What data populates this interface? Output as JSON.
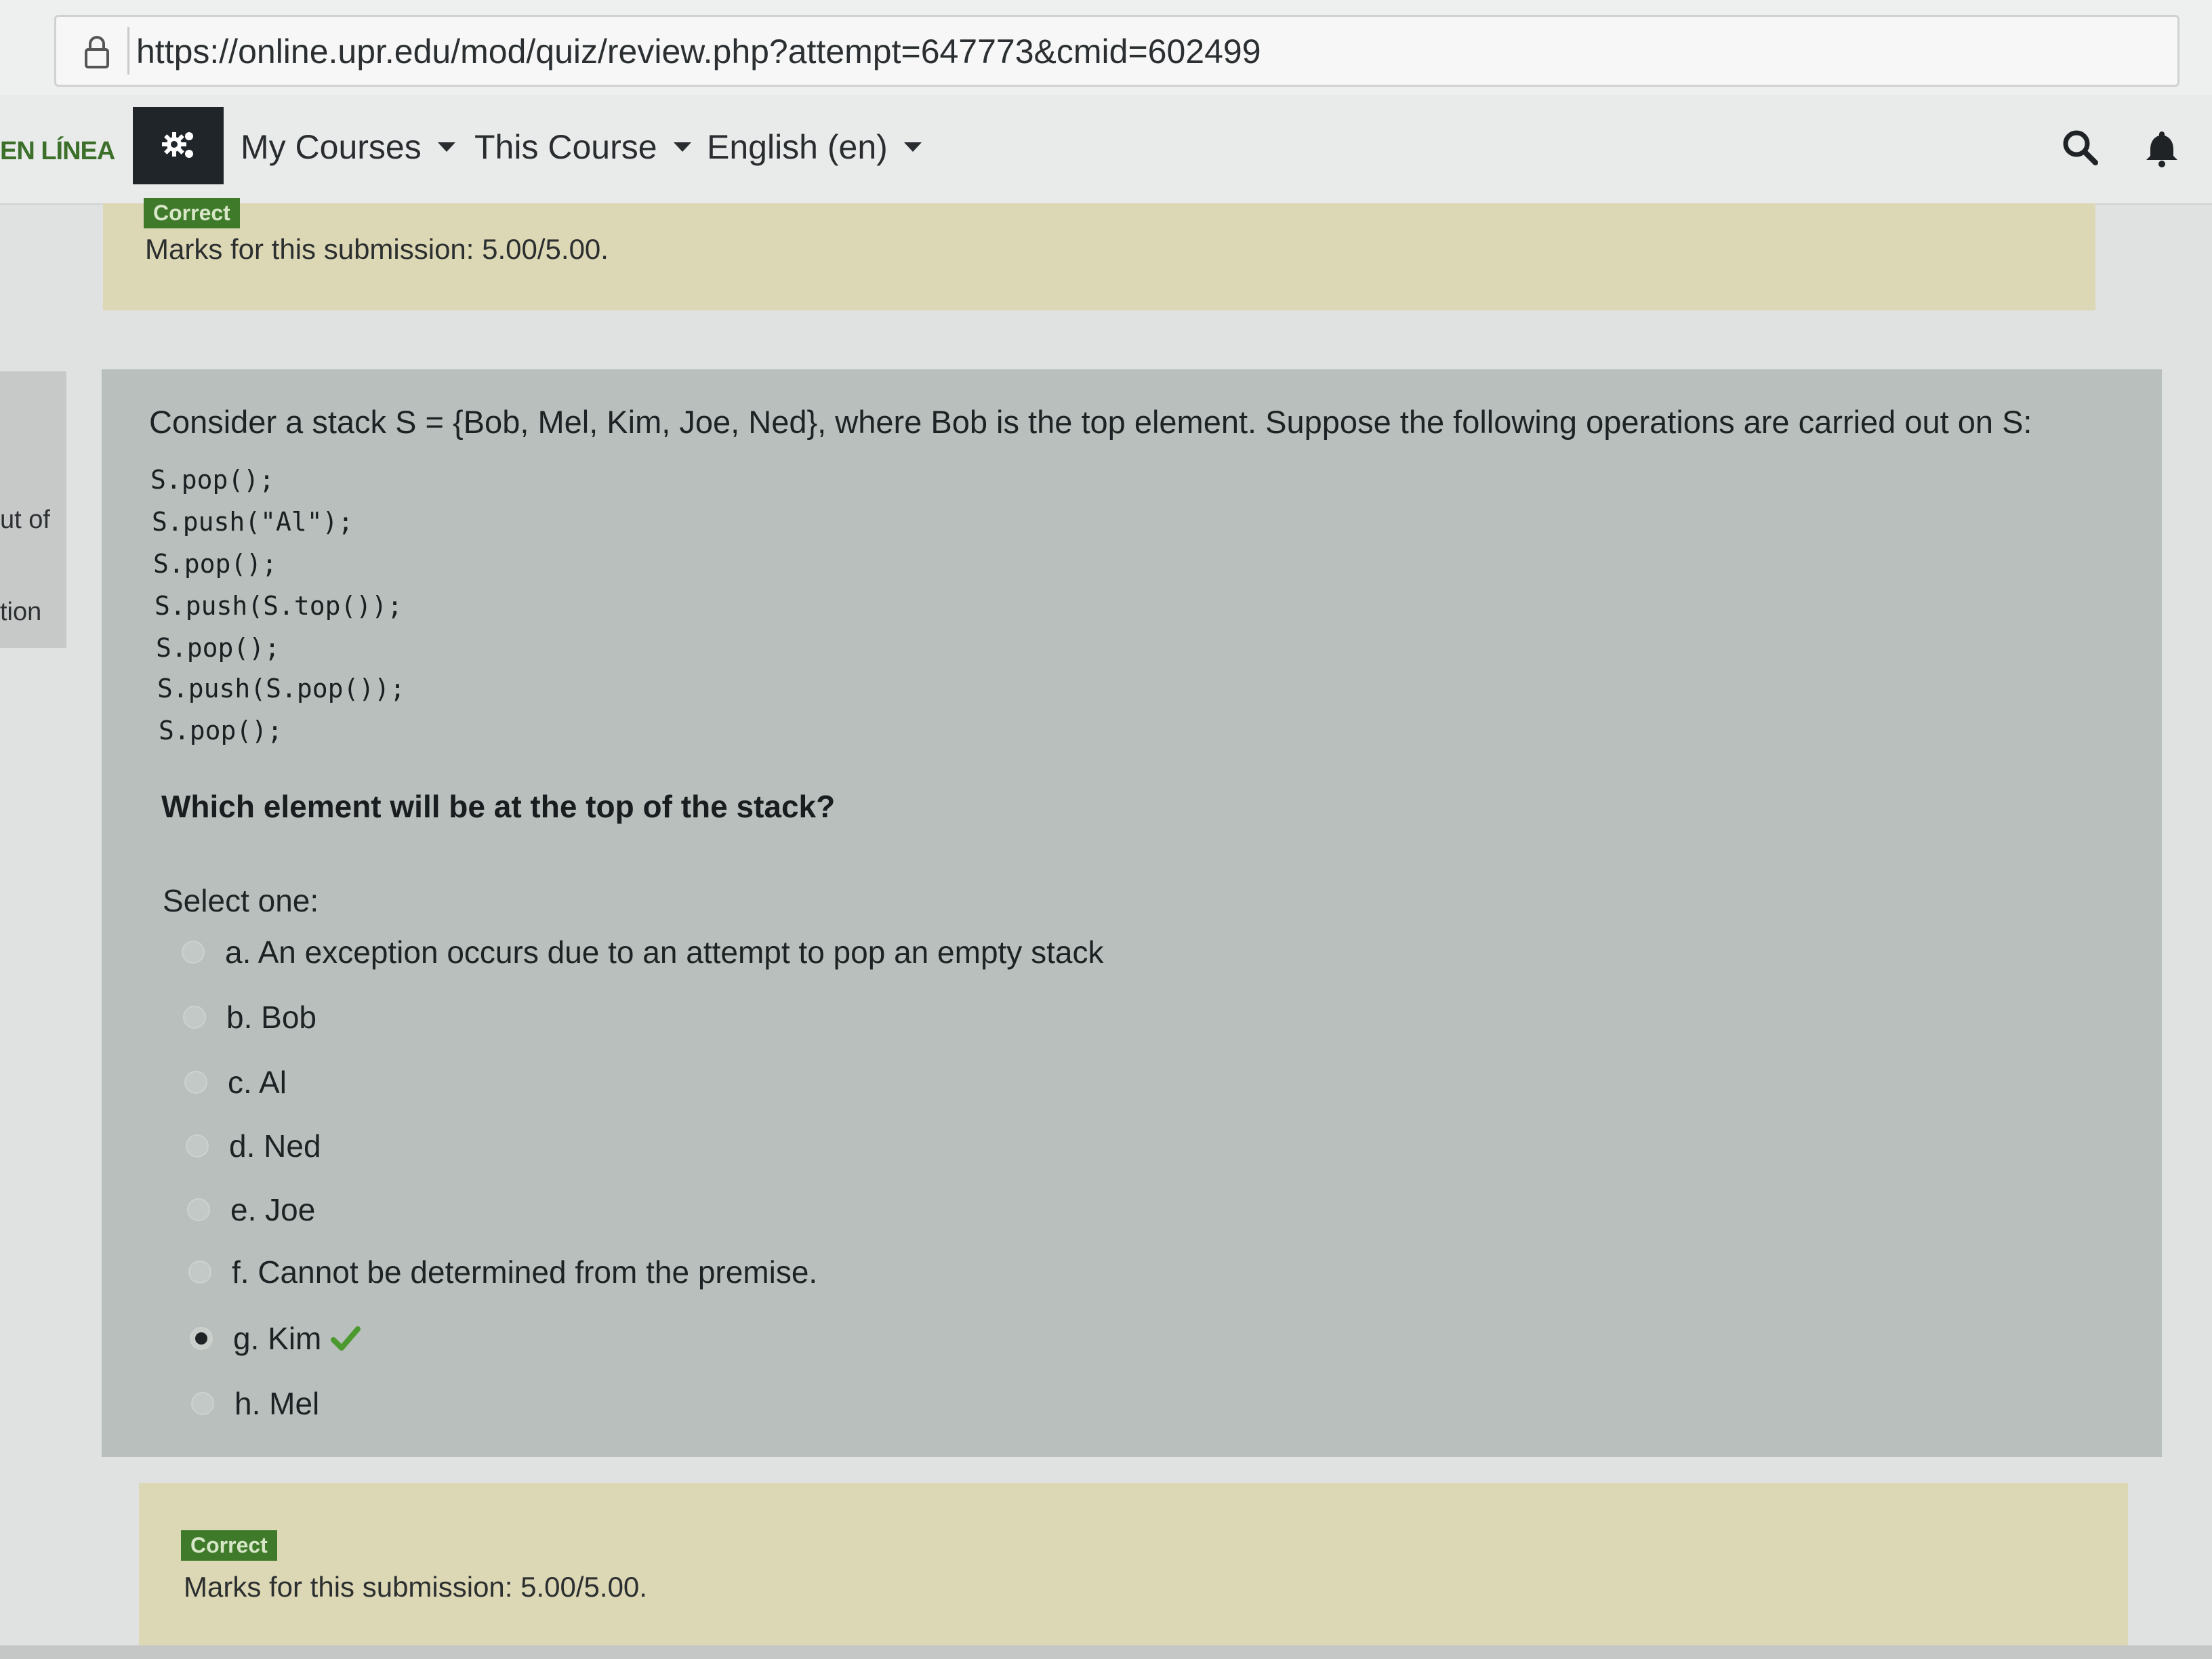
{
  "browser": {
    "url": "https://online.upr.edu/mod/quiz/review.php?attempt=647773&cmid=602499",
    "lock_icon": "lock-icon"
  },
  "navbar": {
    "brand": "EN LÍNEA",
    "gear_icon": "gear-icon",
    "items": [
      {
        "label": "My Courses"
      },
      {
        "label": "This Course"
      },
      {
        "label": "English (en)"
      }
    ],
    "search_icon": "search-icon",
    "bell_icon": "bell-icon"
  },
  "sidebar": {
    "fragments": [
      "ut of",
      "tion"
    ]
  },
  "top_feedback": {
    "badge": "Correct",
    "marks": "Marks for this submission: 5.00/5.00."
  },
  "question": {
    "intro": "Consider a stack S = {Bob, Mel, Kim, Joe, Ned}, where Bob is the top element. Suppose the following operations are carried out on S:",
    "code": [
      "S.pop();",
      "S.push(\"Al\");",
      "S.pop();",
      "S.push(S.top());",
      "S.pop();",
      "S.push(S.pop());",
      "S.pop();"
    ],
    "prompt": "Which element will be at the top of the stack?",
    "select_label": "Select one:",
    "options": [
      {
        "label": "a. An exception occurs due to an attempt to pop an empty stack",
        "selected": false
      },
      {
        "label": "b. Bob",
        "selected": false
      },
      {
        "label": "c. Al",
        "selected": false
      },
      {
        "label": "d. Ned",
        "selected": false
      },
      {
        "label": "e. Joe",
        "selected": false
      },
      {
        "label": "f. Cannot be determined from the premise.",
        "selected": false
      },
      {
        "label": "g. Kim",
        "selected": true,
        "correct": true
      },
      {
        "label": "h. Mel",
        "selected": false
      }
    ]
  },
  "bottom_feedback": {
    "badge": "Correct",
    "marks": "Marks for this submission: 5.00/5.00."
  },
  "colors": {
    "badge_green": "#3f7a2a",
    "check_green": "#4c9a2f",
    "feedback_bg": "#dcd7b4",
    "panel_bg": "#b8bfbc"
  }
}
